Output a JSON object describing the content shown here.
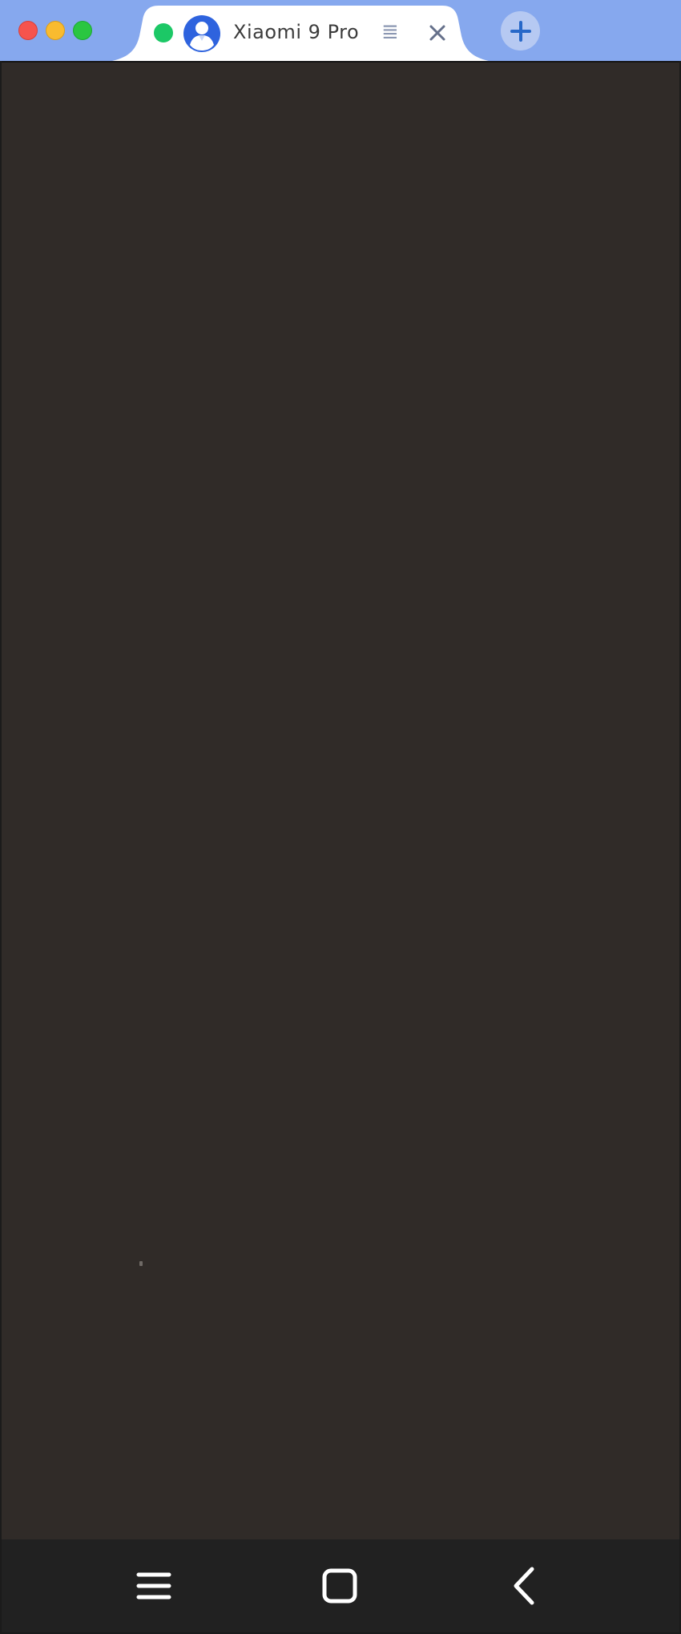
{
  "window": {
    "controls": [
      "close",
      "minimize",
      "maximize"
    ]
  },
  "tab": {
    "title": "Xiaomi 9 Pro",
    "extra_glyph": "≣",
    "status_color": "#1cc866",
    "avatar_icon": "user-avatar-icon",
    "close_icon": "close-icon"
  },
  "new_tab": {
    "icon": "plus-icon"
  },
  "device_nav": {
    "items": [
      "menu-icon",
      "home-icon",
      "back-icon"
    ]
  },
  "colors": {
    "titlebar": "#86a8ee",
    "screen": "#302b28",
    "navbar": "#212121",
    "accent": "#2e63de"
  }
}
